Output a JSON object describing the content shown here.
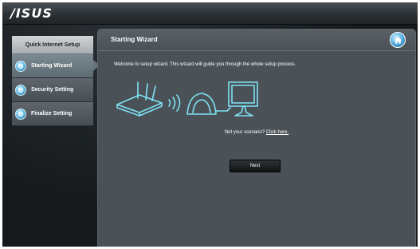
{
  "header": {
    "logo": "/ISUS"
  },
  "sidebar": {
    "title": "Quick Internet Setup",
    "items": [
      {
        "label": "Starting Wizard",
        "icon": "gear-icon",
        "active": true
      },
      {
        "label": "Security Setting",
        "icon": "gear-icon",
        "active": false
      },
      {
        "label": "Finalize Setting",
        "icon": "gear-icon",
        "active": false
      }
    ]
  },
  "panel": {
    "title": "Starting Wizard",
    "home_icon": "home-icon",
    "welcome": "Welcome to setup wizard. This wizard will guide you through the whole setup process.",
    "scenario_text": "Not your scenario?",
    "scenario_link": "Click here.",
    "next_label": "Next"
  },
  "colors": {
    "accent": "#6cc2ea",
    "panel": "#4b5257",
    "illustration": "#7fe2f5"
  }
}
